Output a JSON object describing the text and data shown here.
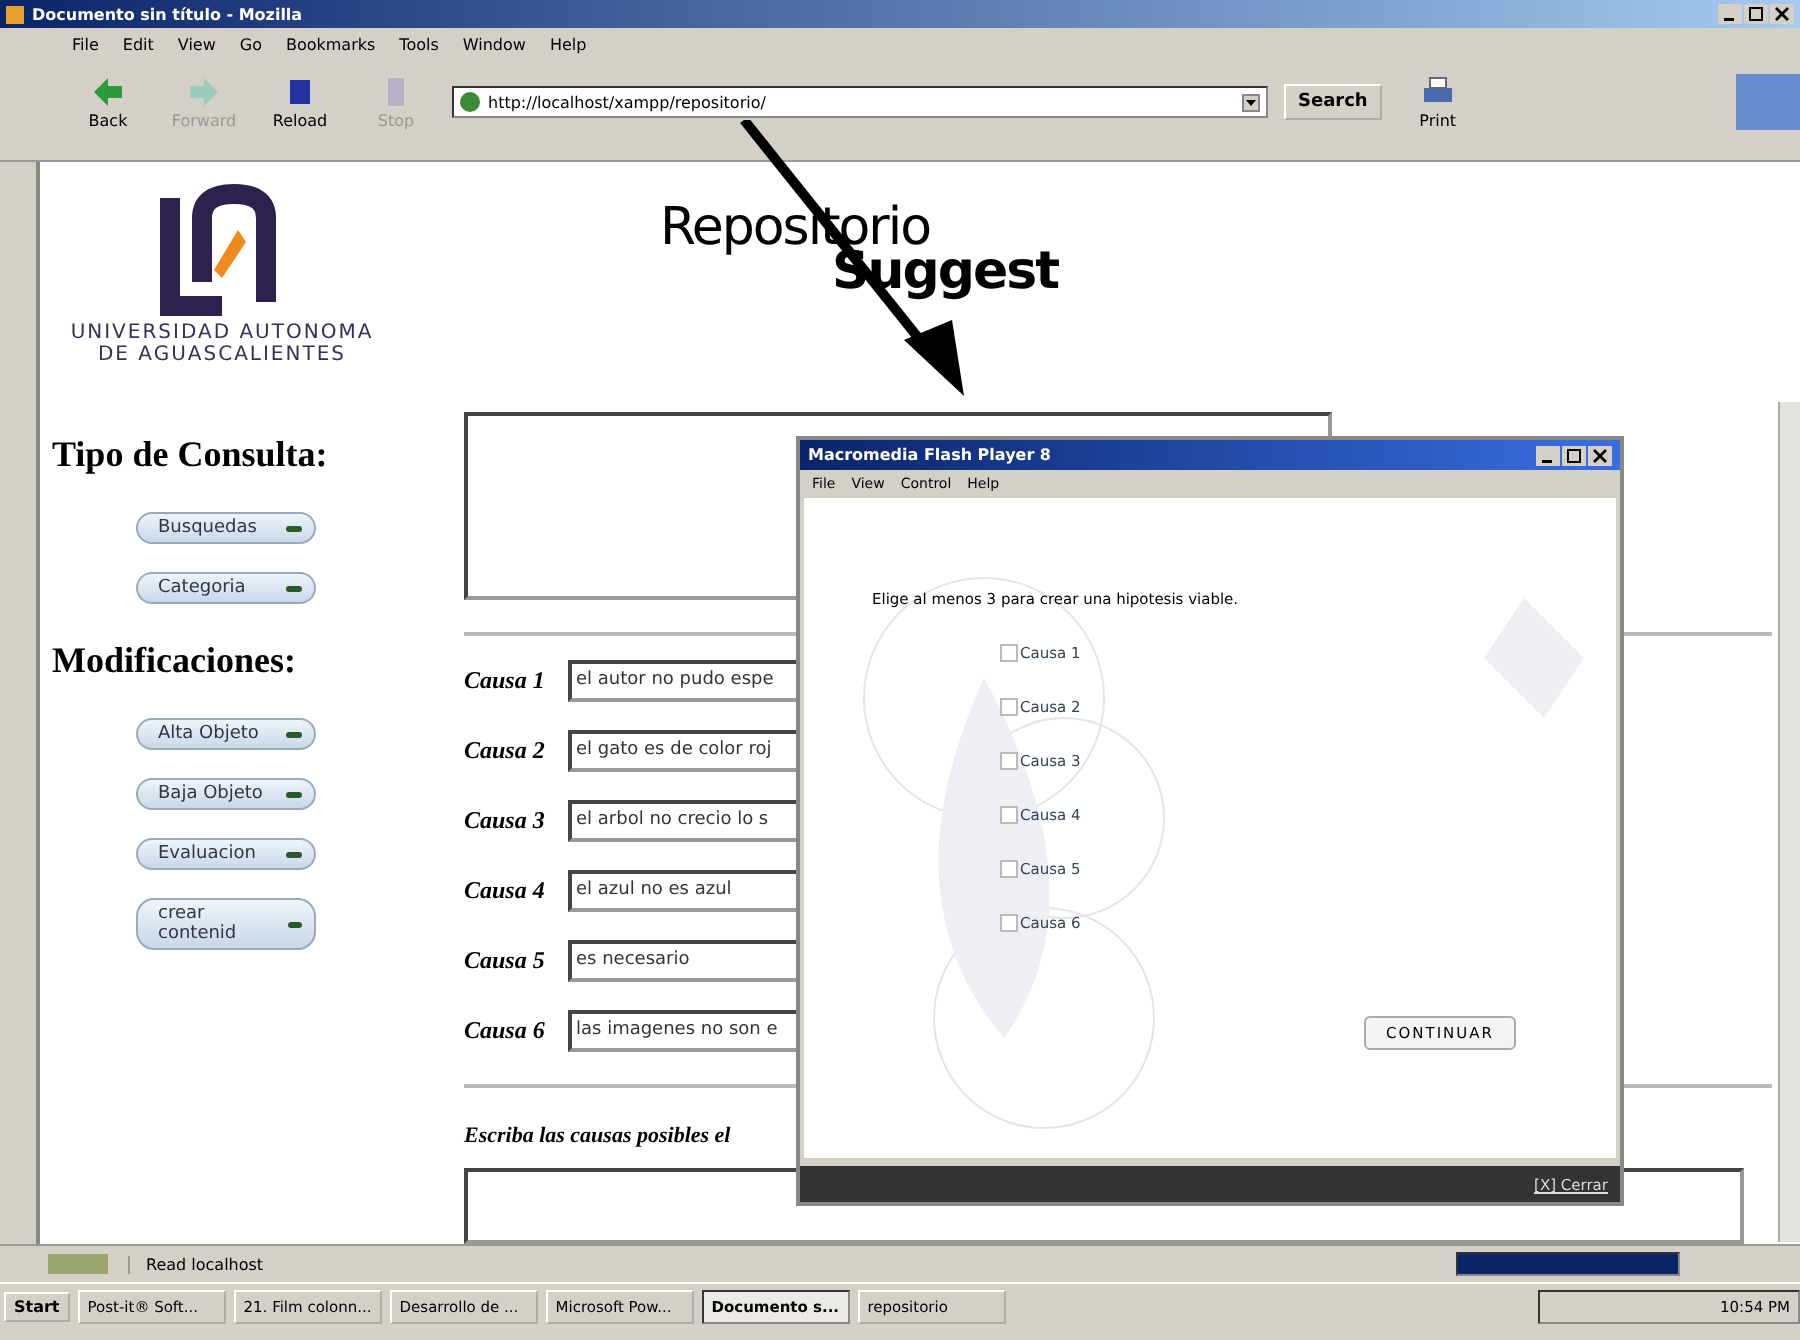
{
  "window": {
    "title": "Documento sin título - Mozilla"
  },
  "menu": [
    "File",
    "Edit",
    "View",
    "Go",
    "Bookmarks",
    "Tools",
    "Window",
    "Help"
  ],
  "toolbar": [
    {
      "label": "Back",
      "kind": "back",
      "disabled": false
    },
    {
      "label": "Forward",
      "kind": "forward",
      "disabled": true
    },
    {
      "label": "Reload",
      "kind": "reload",
      "disabled": false
    },
    {
      "label": "Stop",
      "kind": "stop",
      "disabled": true
    }
  ],
  "address": {
    "value": "http://localhost/xampp/repositorio/"
  },
  "search_button": "Search",
  "print_button": "Print",
  "logo": {
    "line_1": "UNIVERSIDAD AUTONOMA",
    "line_2": "DE AGUASCALIENTES"
  },
  "banner": {
    "line_1": "Repositorio",
    "line_2": "Suggest"
  },
  "sidebar": [
    {
      "heading": "Tipo de Consulta:",
      "buttons": [
        "Busquedas",
        "Categoria"
      ]
    },
    {
      "heading": "Modificaciones:",
      "buttons": [
        "Alta Objeto",
        "Baja Objeto",
        "Evaluacion",
        "crear contenid"
      ]
    }
  ],
  "causes": [
    {
      "label": "Causa 1",
      "value": "el autor no pudo espe"
    },
    {
      "label": "Causa 2",
      "value": "el gato es de color roj"
    },
    {
      "label": "Causa 3",
      "value": "el arbol no crecio lo s"
    },
    {
      "label": "Causa 4",
      "value": "el azul no es azul"
    },
    {
      "label": "Causa 5",
      "value": "es necesario"
    },
    {
      "label": "Causa 6",
      "value": "las imagenes no son e"
    }
  ],
  "prompt": "Escriba las causas posibles el",
  "flash_window": {
    "title": "Macromedia Flash Player 8",
    "menu": [
      "File",
      "View",
      "Control",
      "Help"
    ],
    "instruction": "Elige al menos 3 para crear una hipotesis viable.",
    "options": [
      {
        "label": "Causa 1",
        "checked": false
      },
      {
        "label": "Causa 2",
        "checked": false
      },
      {
        "label": "Causa 3",
        "checked": false
      },
      {
        "label": "Causa 4",
        "checked": false
      },
      {
        "label": "Causa 5",
        "checked": false
      },
      {
        "label": "Causa 6",
        "checked": false
      }
    ],
    "button": "CONTINUAR",
    "close_link": "[X] Cerrar"
  },
  "status_bar": {
    "text": "Read localhost",
    "progress": {
      "level": 1
    }
  },
  "taskbar": {
    "start": "Start",
    "tasks": [
      {
        "label": "Post-it® Soft...",
        "selected": false
      },
      {
        "label": "21. Film colonn...",
        "selected": false
      },
      {
        "label": "Desarrollo de ...",
        "selected": false
      },
      {
        "label": "Microsoft Pow...",
        "selected": false
      },
      {
        "label": "Documento s...",
        "selected": true
      },
      {
        "label": "repositorio",
        "selected": false
      }
    ],
    "clock": "10:54 PM"
  }
}
